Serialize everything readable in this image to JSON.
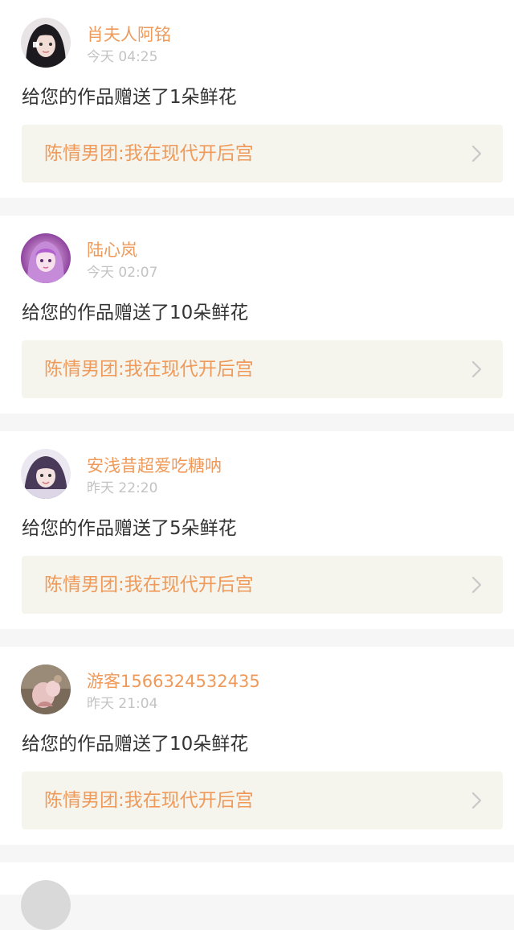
{
  "notifications": [
    {
      "username": "肖夫人阿铭",
      "time": "今天 04:25",
      "message": "给您的作品赠送了1朵鲜花",
      "work_title": "陈情男团:我在现代开后宫",
      "avatar_icon": "user-avatar-1"
    },
    {
      "username": "陆心岚",
      "time": "今天 02:07",
      "message": "给您的作品赠送了10朵鲜花",
      "work_title": "陈情男团:我在现代开后宫",
      "avatar_icon": "user-avatar-2"
    },
    {
      "username": "安浅昔超爱吃糖呐",
      "time": "昨天 22:20",
      "message": "给您的作品赠送了5朵鲜花",
      "work_title": "陈情男团:我在现代开后宫",
      "avatar_icon": "user-avatar-3"
    },
    {
      "username": "游客1566324532435",
      "time": "昨天 21:04",
      "message": "给您的作品赠送了10朵鲜花",
      "work_title": "陈情男团:我在现代开后宫",
      "avatar_icon": "user-avatar-4"
    }
  ],
  "colors": {
    "accent": "#ef9a5a",
    "page_background": "#f6f6f6",
    "card_background": "#ffffff",
    "link_box_background": "#f5f5ee",
    "time_text": "#c3c3c3",
    "message_text": "#333333"
  },
  "icons": {
    "chevron": "chevron-right-icon"
  }
}
